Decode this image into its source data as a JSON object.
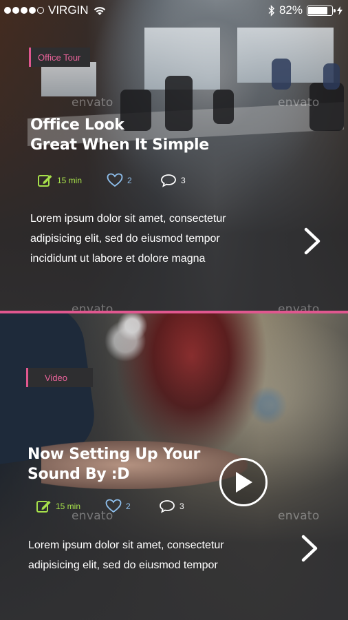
{
  "status_bar": {
    "carrier": "VIRGIN",
    "battery_percent": "82%",
    "battery_level": 0.82,
    "signal_bars_filled": 4,
    "signal_bars_total": 5
  },
  "cards": [
    {
      "tag": "Office Tour",
      "title_line1": "Office Look",
      "title_line2": "Great When It Simple",
      "read_time": "15 min",
      "likes": "2",
      "comments": "3",
      "body_line1": "Lorem ipsum dolor sit amet, consectetur",
      "body_line2": "adipisicing elit, sed do eiusmod tempor",
      "body_line3": "incididunt ut labore et dolore magna"
    },
    {
      "tag": "Video",
      "title_line1": "Now Setting Up Your",
      "title_line2": "Sound By :D",
      "read_time": "15 min",
      "likes": "2",
      "comments": "3",
      "body_line1": "Lorem ipsum dolor sit amet, consectetur",
      "body_line2": "adipisicing elit, sed do eiusmod tempor"
    }
  ],
  "watermark": "envato",
  "colors": {
    "accent": "#e0578f",
    "time_green": "#a6e04a",
    "like_blue": "#8fc0ee",
    "card_bg": "#2e2e30"
  },
  "icons": {
    "edit": "edit-icon",
    "heart": "heart-icon",
    "comment": "comment-icon",
    "next": "chevron-right-icon",
    "play": "play-icon"
  }
}
